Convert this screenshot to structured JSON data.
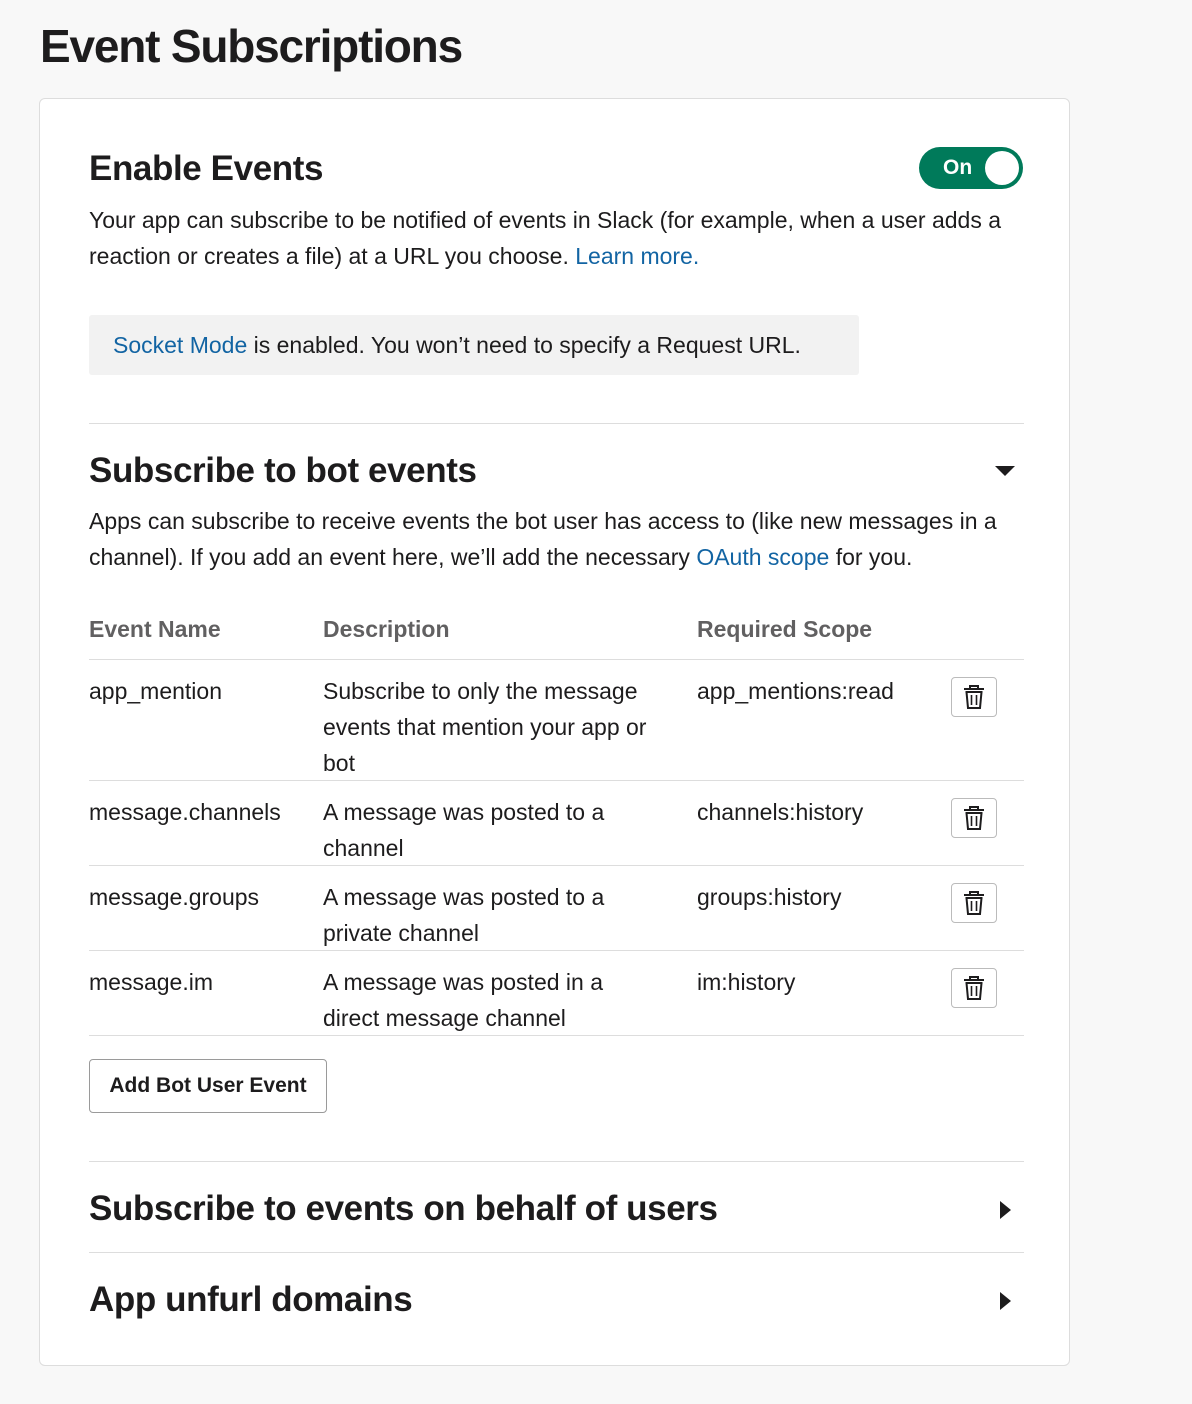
{
  "page": {
    "title": "Event Subscriptions"
  },
  "enable_events": {
    "heading": "Enable Events",
    "toggle_label": "On",
    "toggle_on": true,
    "description": "Your app can subscribe to be notified of events in Slack (for example, when a user adds a reaction or creates a file) at a URL you choose.",
    "learn_more_link": "Learn more.",
    "notice_link": "Socket Mode",
    "notice_text": "is enabled. You won’t need to specify a Request URL."
  },
  "bot_events": {
    "heading": "Subscribe to bot events",
    "description_before": "Apps can subscribe to receive events the bot user has access to (like new messages in a channel). If you add an event here, we’ll add the necessary",
    "oauth_link": "OAuth scope",
    "description_after": "for you.",
    "columns": {
      "event_name": "Event Name",
      "description": "Description",
      "required_scope": "Required Scope"
    },
    "events": [
      {
        "name": "app_mention",
        "description": "Subscribe to only the message events that mention your app or bot",
        "scope": "app_mentions:read"
      },
      {
        "name": "message.channels",
        "description": "A message was posted to a channel",
        "scope": "channels:history"
      },
      {
        "name": "message.groups",
        "description": "A message was posted to a private channel",
        "scope": "groups:history"
      },
      {
        "name": "message.im",
        "description": "A message was posted in a direct message channel",
        "scope": "im:history"
      }
    ],
    "add_button": "Add Bot User Event"
  },
  "user_events": {
    "heading": "Subscribe to events on behalf of users"
  },
  "unfurl": {
    "heading": "App unfurl domains"
  },
  "colors": {
    "accent_green": "#007a5a",
    "link_blue": "#1264a3",
    "text": "#1d1c1d",
    "muted": "#616061"
  },
  "icons": {
    "delete": "trash-icon",
    "expanded": "caret-down-icon",
    "collapsed": "caret-right-icon"
  }
}
